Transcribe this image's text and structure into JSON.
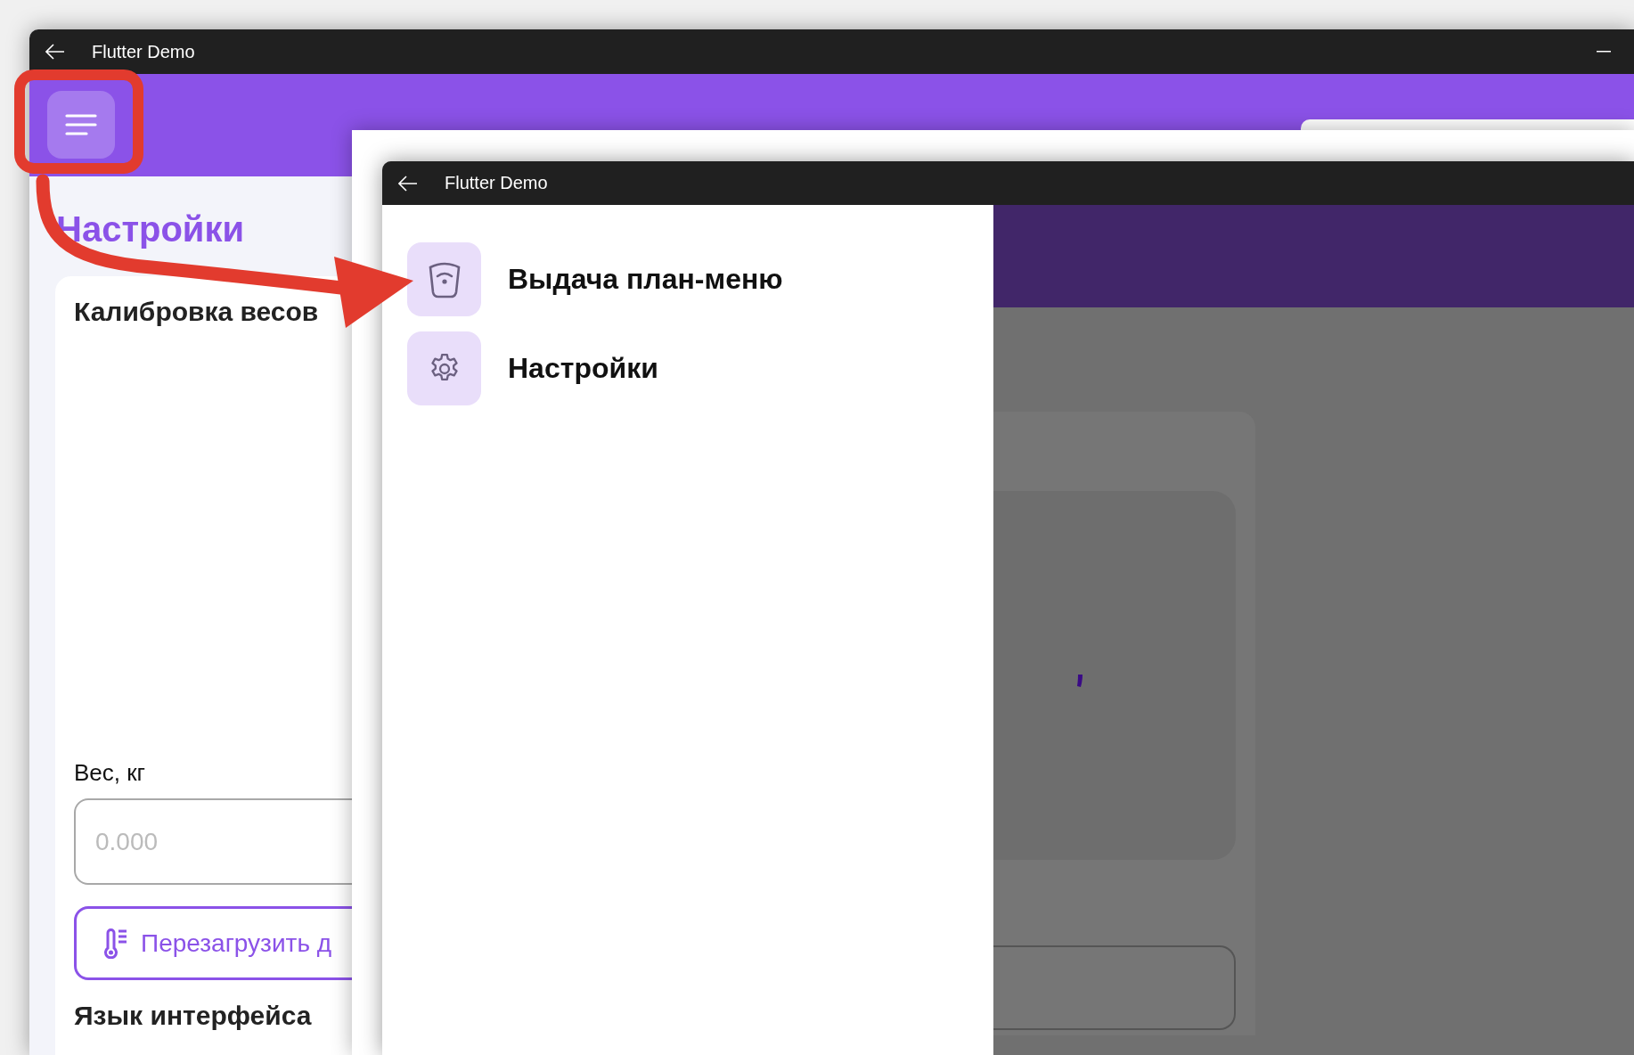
{
  "back_window": {
    "title": "Flutter Demo",
    "page_title": "Настройки",
    "card": {
      "title": "Калибровка весов",
      "weight_label": "Вес, кг",
      "weight_field": {
        "placeholder": "0.000"
      },
      "reload_button": "Перезагрузить д",
      "next_section": "Язык интерфейса"
    }
  },
  "front_window": {
    "title": "Flutter Demo",
    "drawer": {
      "items": [
        {
          "label": "Выдача план-меню",
          "kind": "shield"
        },
        {
          "label": "Настройки",
          "kind": "gear"
        }
      ]
    }
  }
}
